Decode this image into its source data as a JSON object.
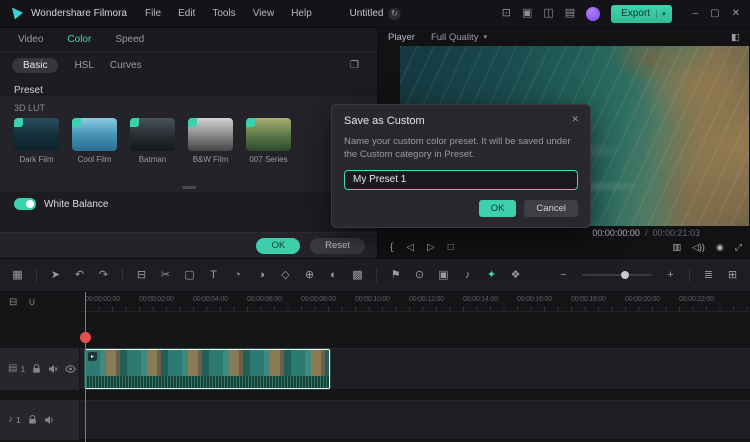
{
  "colors": {
    "accent": "#45d6b3",
    "playhead": "#e8514b",
    "avatar": "#8a5cf6"
  },
  "topbar": {
    "app_title": "Wondershare Filmora",
    "menus": [
      "File",
      "Edit",
      "Tools",
      "View",
      "Help"
    ],
    "project_name": "Untitled",
    "sync_glyph": "↻",
    "icons": [
      {
        "name": "layout",
        "glyph": "⊡"
      },
      {
        "name": "screen-record",
        "glyph": "▣"
      },
      {
        "name": "resources",
        "glyph": "◫"
      },
      {
        "name": "notifications",
        "glyph": "▤"
      }
    ],
    "export_label": "Export",
    "caret": "▾",
    "window": {
      "minimize": "–",
      "maximize": "▢",
      "close": "✕"
    }
  },
  "color_panel": {
    "tabs": [
      "Video",
      "Color",
      "Speed"
    ],
    "active_tab": "Color",
    "subtabs": [
      "Basic",
      "HSL",
      "Curves"
    ],
    "active_subtab": "Basic",
    "save_preset_glyph": "❐",
    "preset_label": "Preset",
    "lut_title": "3D LUT",
    "luts": [
      "Dark Film",
      "Cool Film",
      "Batman",
      "B&W Film",
      "007 Series"
    ],
    "white_balance_label": "White Balance",
    "white_balance_on": true,
    "ok_label": "OK",
    "reset_label": "Reset"
  },
  "player": {
    "title": "Player",
    "quality": "Full Quality",
    "caret": "▾",
    "compare_glyph": "◧",
    "timecode_current": "00:00:00:00",
    "timecode_separator": "/",
    "timecode_total": "00:00:21:03",
    "controls_left": [
      {
        "name": "mark-in",
        "glyph": "{"
      },
      {
        "name": "prev-frame",
        "glyph": "◁"
      },
      {
        "name": "play",
        "glyph": "▷"
      },
      {
        "name": "stop",
        "glyph": "□"
      }
    ],
    "controls_right": [
      {
        "name": "display",
        "glyph": "▥"
      },
      {
        "name": "volume",
        "glyph": "◁))"
      },
      {
        "name": "snapshot",
        "glyph": "◉"
      },
      {
        "name": "fullscreen",
        "glyph": "⤢"
      }
    ]
  },
  "dialog": {
    "title": "Save as Custom",
    "close_glyph": "✕",
    "message": "Name your custom color preset. It will be saved under the Custom category in Preset.",
    "input_value": "My Preset 1",
    "ok_label": "OK",
    "cancel_label": "Cancel"
  },
  "toolbar": {
    "icons_left": [
      {
        "name": "media",
        "glyph": "▦"
      },
      {
        "name": "pointer",
        "glyph": "➤"
      },
      {
        "name": "undo",
        "glyph": "↶"
      },
      {
        "name": "redo",
        "glyph": "↷"
      },
      {
        "name": "delete",
        "glyph": "⊟"
      },
      {
        "name": "split",
        "glyph": "✂"
      },
      {
        "name": "crop",
        "glyph": "▢"
      },
      {
        "name": "text",
        "glyph": "T"
      },
      {
        "name": "speed",
        "glyph": "◔"
      },
      {
        "name": "color",
        "glyph": "◑"
      },
      {
        "name": "keyframe",
        "glyph": "◇"
      },
      {
        "name": "motion-track",
        "glyph": "⊕"
      },
      {
        "name": "mask",
        "glyph": "◐"
      },
      {
        "name": "green-screen",
        "glyph": "▩"
      }
    ],
    "icons_mid": [
      {
        "name": "marker",
        "glyph": "⚑"
      },
      {
        "name": "voiceover",
        "glyph": "⊙"
      },
      {
        "name": "record-screen",
        "glyph": "▣"
      },
      {
        "name": "audio-mixer",
        "glyph": "♪"
      },
      {
        "name": "ai-tools",
        "glyph": "✦"
      },
      {
        "name": "effects",
        "glyph": "❖"
      }
    ],
    "zoom_out": "−",
    "zoom_in": "+",
    "icons_right": [
      {
        "name": "track-options",
        "glyph": "≣"
      },
      {
        "name": "fit-timeline",
        "glyph": "⊞"
      }
    ]
  },
  "timeline": {
    "corner_icons": [
      {
        "name": "manage-tracks",
        "glyph": "⊟"
      },
      {
        "name": "snap",
        "glyph": "∪"
      }
    ],
    "ruler": [
      "00:00:00:00",
      "00:00:02:00",
      "00:00:04:00",
      "00:00:06:00",
      "00:00:08:00",
      "00:00:10:00",
      "00:00:12:00",
      "00:00:14:00",
      "00:00:16:00",
      "00:00:18:00",
      "00:00:20:00",
      "00:00:22:00"
    ],
    "clip_badge_glyph": "▸",
    "video_track": {
      "icon": "▤",
      "number": "1"
    },
    "audio_track": {
      "icon": "♪",
      "number": "1"
    }
  }
}
